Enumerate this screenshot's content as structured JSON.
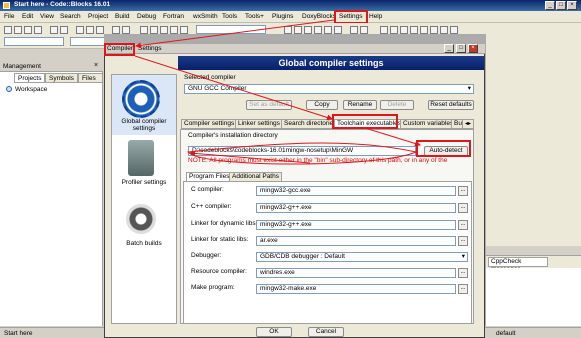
{
  "window": {
    "title": "Start here - Code::Blocks 16.01"
  },
  "menu": [
    "File",
    "Edit",
    "View",
    "Search",
    "Project",
    "Build",
    "Debug",
    "Fortran",
    "wxSmith",
    "Tools",
    "Tools+",
    "Plugins",
    "DoxyBlocks",
    "Settings",
    "Help"
  ],
  "doc_tabs": {
    "compiler": "Compiler",
    "settings": "Settings"
  },
  "management": {
    "title": "Management",
    "tabs": [
      "Projects",
      "Symbols",
      "Files"
    ],
    "tree_root": "Workspace"
  },
  "right_panel": {
    "cppcheck": "CppCheck messages"
  },
  "status": {
    "left": "Start here",
    "right": "default"
  },
  "dialog": {
    "header": "Global compiler settings",
    "nav": [
      {
        "label": "Global compiler settings"
      },
      {
        "label": "Profiler settings"
      },
      {
        "label": "Batch builds"
      }
    ],
    "selected_compiler_label": "Selected compiler",
    "selected_compiler": "GNU GCC Compiler",
    "buttons": {
      "set_default": "Set as default",
      "copy": "Copy",
      "rename": "Rename",
      "delete": "Delete",
      "reset_defaults": "Reset defaults",
      "auto_detect": "Auto-detect",
      "ok": "OK",
      "cancel": "Cancel"
    },
    "tabs": [
      "Compiler settings",
      "Linker settings",
      "Search directories",
      "Toolchain executables",
      "Custom variables",
      "Bu"
    ],
    "install_dir_label": "Compiler's installation directory",
    "install_dir": "D:\\codeblocks\\codeblocks-16.01mingw-nosetup\\MinGW",
    "note": "NOTE: All programs must exist either in the \"bin\" sub-directory of this path, or in any of the",
    "subtabs": [
      "Program Files",
      "Additional Paths"
    ],
    "programs": [
      {
        "label": "C compiler:",
        "value": "mingw32-gcc.exe"
      },
      {
        "label": "C++ compiler:",
        "value": "mingw32-g++.exe"
      },
      {
        "label": "Linker for dynamic libs:",
        "value": "mingw32-g++.exe"
      },
      {
        "label": "Linker for static libs:",
        "value": "ar.exe"
      },
      {
        "label": "Debugger:",
        "value": "GDB/CDB debugger : Default"
      },
      {
        "label": "Resource compiler:",
        "value": "windres.exe"
      },
      {
        "label": "Make program:",
        "value": "mingw32-make.exe"
      }
    ],
    "ellipsis": "..."
  },
  "colors": {
    "annotation": "#e0161d",
    "header_bg": "#08206a"
  }
}
